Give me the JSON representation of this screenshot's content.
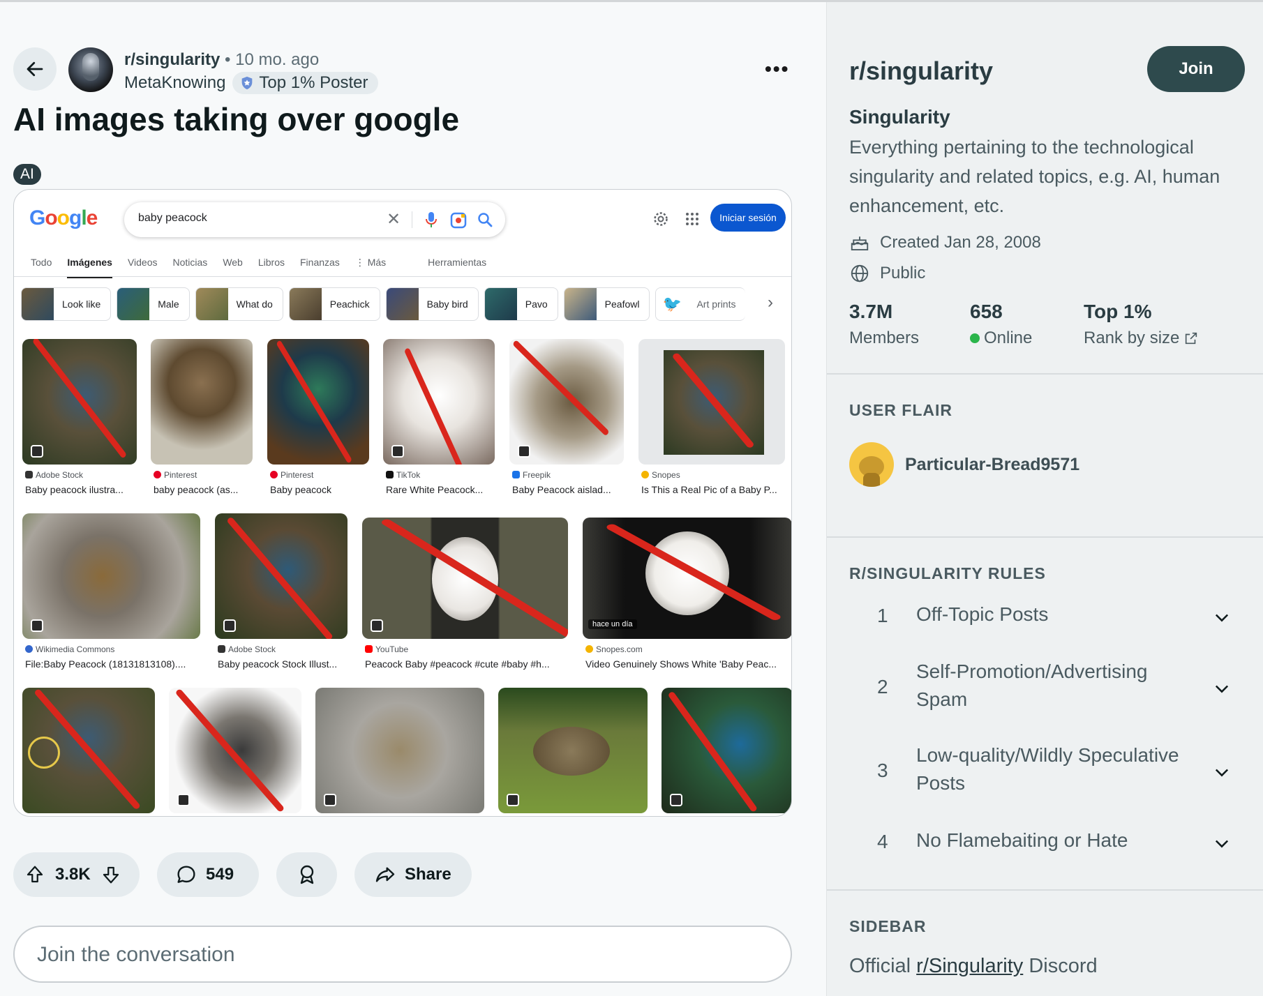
{
  "post": {
    "subreddit": "r/singularity",
    "separator": "•",
    "age": "10 mo. ago",
    "author": "MetaKnowing",
    "author_flair": "Top 1% Poster",
    "title": "AI images taking over google",
    "tag": "AI"
  },
  "google": {
    "logo_letters": [
      "G",
      "o",
      "o",
      "g",
      "l",
      "e"
    ],
    "query": "baby peacock",
    "signin_label": "Iniciar sesión",
    "tabs": [
      "Todo",
      "Imágenes",
      "Videos",
      "Noticias",
      "Web",
      "Libros",
      "Finanzas",
      "⋮ Más",
      "Herramientas"
    ],
    "active_tab": "Imágenes",
    "chips": [
      "Look like",
      "Male",
      "What do",
      "Peachick",
      "Baby bird",
      "Pavo",
      "Peafowl",
      "Art prints"
    ],
    "results_row1": [
      {
        "source": "Adobe Stock",
        "title": "Baby peacock ilustra...",
        "crossed": true
      },
      {
        "source": "Pinterest",
        "title": "baby peacock (as...",
        "crossed": false
      },
      {
        "source": "Pinterest",
        "title": "Baby peacock",
        "crossed": true
      },
      {
        "source": "TikTok",
        "title": "Rare White Peacock...",
        "crossed": true
      },
      {
        "source": "Freepik",
        "title": "Baby Peacock aislad...",
        "crossed": true
      },
      {
        "source": "Snopes",
        "title": "Is This a Real Pic of a Baby P...",
        "crossed": true
      }
    ],
    "results_row2": [
      {
        "source": "Wikimedia Commons",
        "title": "File:Baby Peacock (18131813108)....",
        "crossed": false
      },
      {
        "source": "Adobe Stock",
        "title": "Baby peacock Stock Illust...",
        "crossed": true
      },
      {
        "source": "YouTube",
        "title": "Peacock Baby #peacock #cute #baby #h...",
        "crossed": true
      },
      {
        "source": "Snopes.com",
        "title": "Video Genuinely Shows White 'Baby Peac...",
        "crossed": true,
        "overlay": "hace un día"
      }
    ],
    "results_row3_crossed": [
      true,
      true,
      false,
      false,
      true
    ]
  },
  "actions": {
    "upvotes": "3.8K",
    "comments": "549",
    "share_label": "Share",
    "comment_placeholder": "Join the conversation"
  },
  "sidebar": {
    "title": "r/singularity",
    "join_label": "Join",
    "name": "Singularity",
    "description": "Everything pertaining to the technological singularity and related topics, e.g. AI, human enhancement, etc.",
    "created": "Created Jan 28, 2008",
    "visibility": "Public",
    "stats": [
      {
        "value": "3.7M",
        "label": "Members"
      },
      {
        "value": "658",
        "label": "Online"
      },
      {
        "value": "Top 1%",
        "label": "Rank by size"
      }
    ],
    "user_flair_heading": "USER FLAIR",
    "flair_user": "Particular-Bread9571",
    "rules_heading": "R/SINGULARITY RULES",
    "rules": [
      {
        "num": "1",
        "text": "Off-Topic Posts"
      },
      {
        "num": "2",
        "text": "Self-Promotion/Advertising Spam"
      },
      {
        "num": "3",
        "text": "Low-quality/Wildly Speculative Posts"
      },
      {
        "num": "4",
        "text": "No Flamebaiting or Hate"
      }
    ],
    "sidebar_heading": "SIDEBAR",
    "discord_prefix": "Official",
    "discord_link": "r/Singularity",
    "discord_suffix": "Discord"
  },
  "colors": {
    "join_bg": "#2e4a4d",
    "online": "#2ab54b",
    "google_blue": "#0b57d0",
    "red_slash": "#d9261c"
  }
}
